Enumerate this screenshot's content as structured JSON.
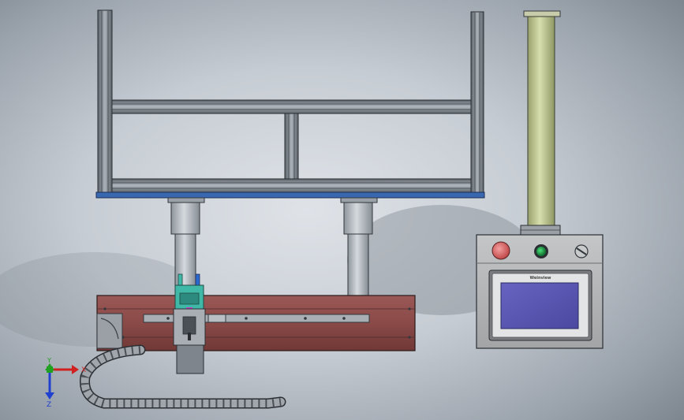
{
  "viewport": {
    "triad": {
      "x_label": "X",
      "y_label": "Y",
      "z_label": "Z"
    }
  },
  "control_box": {
    "screen_brand": "Weinview"
  },
  "colors": {
    "frame_metal": "#8a929a",
    "base_plate": "#3a68b0",
    "beam_red": "#8a4a48",
    "pillar_grey": "#b6bcc2",
    "tower_green": "#c4cc98",
    "panel_grey": "#b4b6b8",
    "screen_blue": "#5a58b0",
    "estop_red": "#e07070",
    "start_green": "#22a04a",
    "gripper_teal": "#40b8a8",
    "axis_x": "#d02020",
    "axis_y": "#20a020",
    "axis_z": "#2040d0"
  }
}
